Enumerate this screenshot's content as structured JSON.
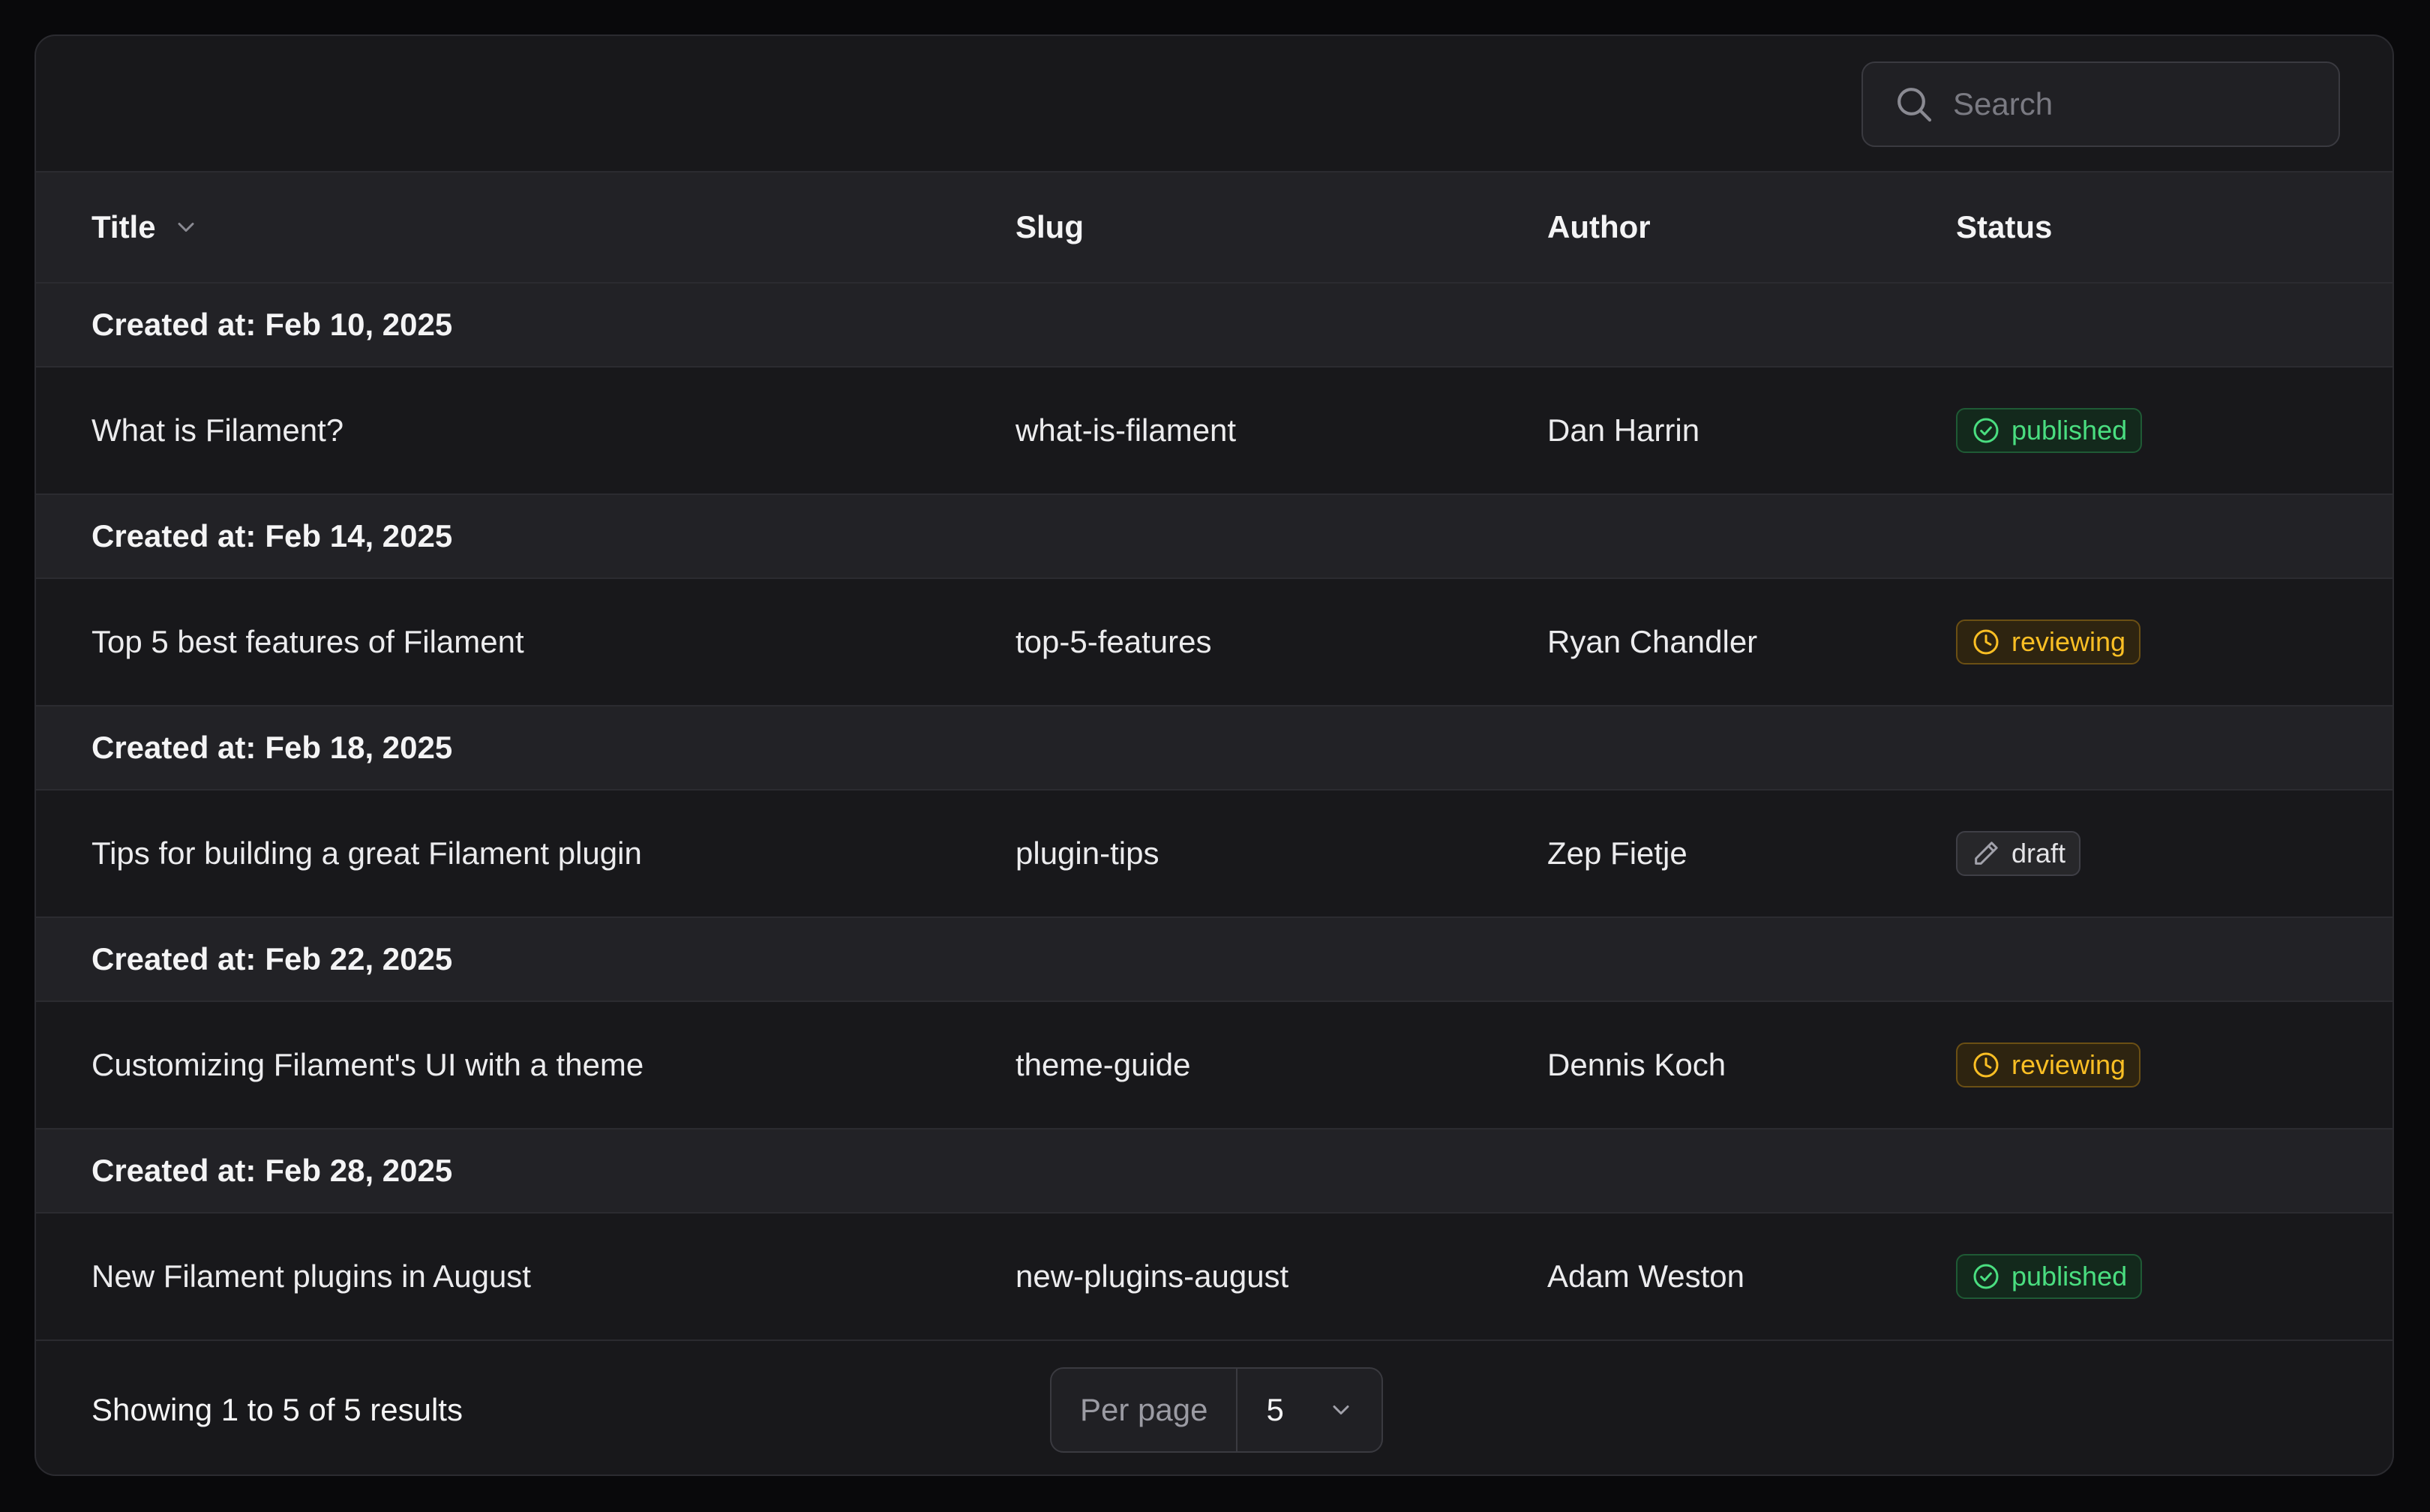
{
  "search": {
    "placeholder": "Search"
  },
  "columns": {
    "title": "Title",
    "slug": "Slug",
    "author": "Author",
    "status": "Status"
  },
  "group_label": "Created at:",
  "groups": [
    {
      "date": "Feb 10, 2025",
      "title": "What is Filament?",
      "slug": "what-is-filament",
      "author": "Dan Harrin",
      "status": "published"
    },
    {
      "date": "Feb 14, 2025",
      "title": "Top 5 best features of Filament",
      "slug": "top-5-features",
      "author": "Ryan Chandler",
      "status": "reviewing"
    },
    {
      "date": "Feb 18, 2025",
      "title": "Tips for building a great Filament plugin",
      "slug": "plugin-tips",
      "author": "Zep Fietje",
      "status": "draft"
    },
    {
      "date": "Feb 22, 2025",
      "title": "Customizing Filament's UI with a theme",
      "slug": "theme-guide",
      "author": "Dennis Koch",
      "status": "reviewing"
    },
    {
      "date": "Feb 28, 2025",
      "title": "New Filament plugins in August",
      "slug": "new-plugins-august",
      "author": "Adam Weston",
      "status": "published"
    }
  ],
  "footer": {
    "summary": "Showing 1 to 5 of 5 results",
    "per_page_label": "Per page",
    "per_page_value": "5"
  },
  "colors": {
    "published": "#4ade80",
    "reviewing": "#fbbf24",
    "draft": "#e4e4e7"
  }
}
